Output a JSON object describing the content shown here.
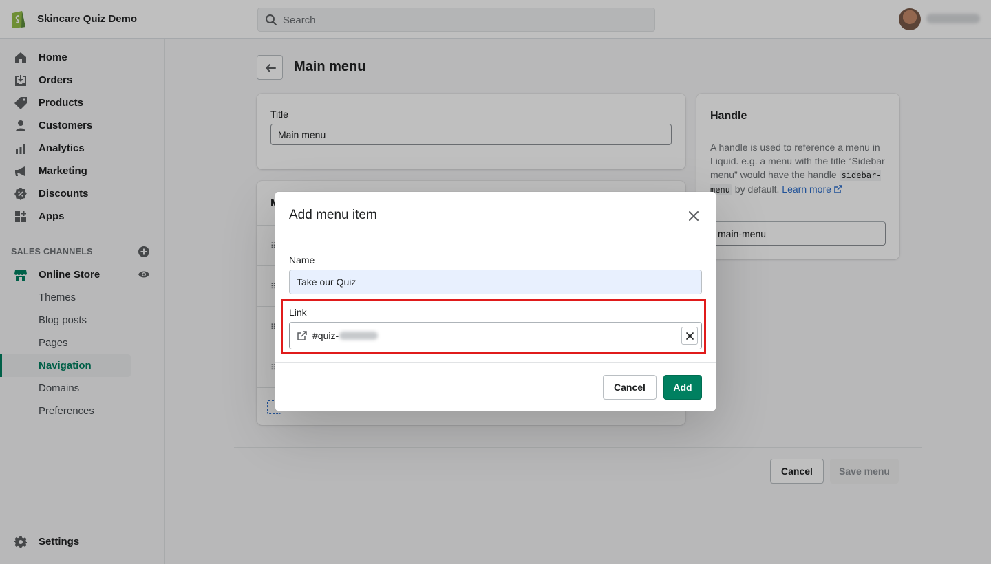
{
  "topbar": {
    "store_name": "Skincare Quiz Demo",
    "search_placeholder": "Search"
  },
  "sidebar": {
    "items": [
      {
        "label": "Home",
        "icon": "home-icon"
      },
      {
        "label": "Orders",
        "icon": "orders-icon"
      },
      {
        "label": "Products",
        "icon": "tag-icon"
      },
      {
        "label": "Customers",
        "icon": "person-icon"
      },
      {
        "label": "Analytics",
        "icon": "bar-chart-icon"
      },
      {
        "label": "Marketing",
        "icon": "megaphone-icon"
      },
      {
        "label": "Discounts",
        "icon": "discount-icon"
      },
      {
        "label": "Apps",
        "icon": "apps-icon"
      }
    ],
    "sales_channels_title": "SALES CHANNELS",
    "online_store": "Online Store",
    "sub_items": [
      "Themes",
      "Blog posts",
      "Pages",
      "Navigation",
      "Domains",
      "Preferences"
    ],
    "active_sub_item": "Navigation",
    "settings": "Settings"
  },
  "main": {
    "page_title": "Main menu",
    "title_label": "Title",
    "title_value": "Main menu",
    "menu_items_heading_partial": "M",
    "handle": {
      "title": "Handle",
      "desc_1": "A handle is used to reference a menu in Liquid. e.g. a menu with the title “Sidebar menu” would have the handle",
      "code": "sidebar-menu",
      "desc_2": "by default.",
      "learn_more": "Learn more",
      "value": "main-menu"
    },
    "footer": {
      "cancel": "Cancel",
      "save": "Save menu"
    }
  },
  "modal": {
    "title": "Add menu item",
    "name_label": "Name",
    "name_value": "Take our Quiz",
    "link_label": "Link",
    "link_value": "#quiz-",
    "cancel": "Cancel",
    "add": "Add"
  },
  "colors": {
    "primary": "#008060",
    "highlight": "#e01b1b",
    "link": "#2c6ecb"
  }
}
